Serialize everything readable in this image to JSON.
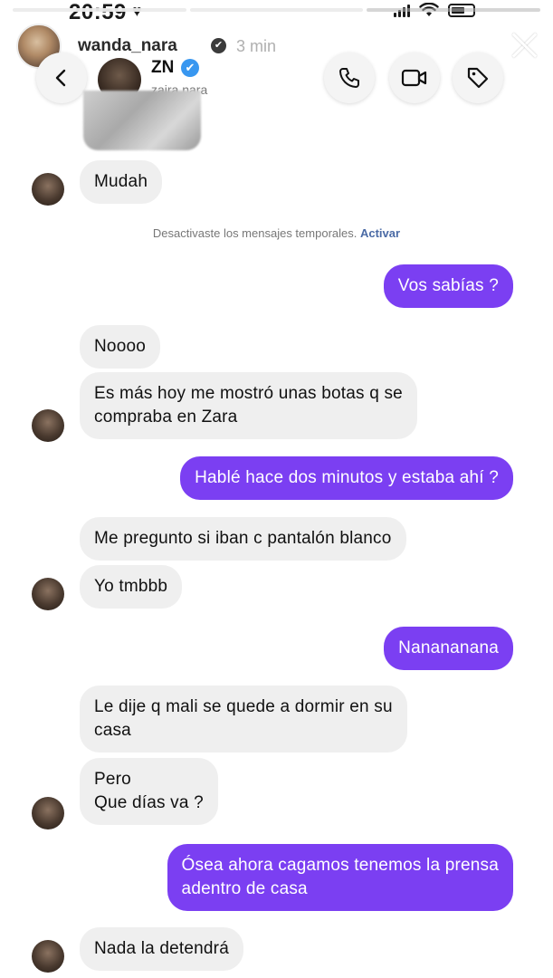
{
  "status_bar": {
    "time": "20:59",
    "heart": "♥"
  },
  "story": {
    "username": "wanda_nara",
    "verified_mark": "✔",
    "time_ago": "3 min"
  },
  "chat": {
    "name": "ZN",
    "verified_mark": "✔",
    "handle": "zaira.nara",
    "system_note": "Desactivaste los mensajes temporales.",
    "system_link": "Activar",
    "messages": [
      {
        "side": "in",
        "text": "Mudah"
      },
      {
        "side": "out",
        "text": "Vos sabías ?"
      },
      {
        "side": "in",
        "text": "Noooo"
      },
      {
        "side": "in",
        "text": "Es más hoy me mostró unas botas q se\ncompraba en Zara"
      },
      {
        "side": "out",
        "text": "Hablé hace dos minutos y estaba ahí ?"
      },
      {
        "side": "in",
        "text": "Me pregunto si iban c pantalón blanco"
      },
      {
        "side": "in",
        "text": "Yo tmbbb"
      },
      {
        "side": "out",
        "text": "Nanananana"
      },
      {
        "side": "in",
        "text": "Le dije q mali se quede a dormir en su\ncasa"
      },
      {
        "side": "in",
        "text": "Pero\nQue días va ?"
      },
      {
        "side": "out",
        "text": "Ósea ahora cagamos tenemos la prensa\nadentro de casa"
      },
      {
        "side": "in",
        "text": "Nada la detendrá"
      }
    ]
  },
  "icons": [
    "back-icon",
    "phone-icon",
    "video-icon",
    "tag-icon",
    "close-icon"
  ],
  "colors": {
    "outgoing_bubble": "#7b3ff2",
    "incoming_bubble": "#efefef",
    "link": "#4a6aa5"
  }
}
